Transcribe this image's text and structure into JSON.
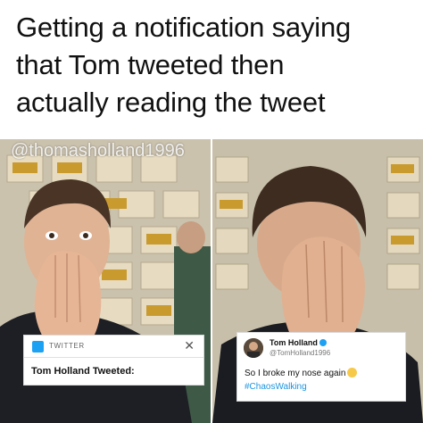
{
  "caption": {
    "line1": "Getting a notification saying",
    "line2": "that Tom tweeted then",
    "line3": "actually reading the tweet"
  },
  "watermark": "@thomasholland1996",
  "notification": {
    "app_label": "TWITTER",
    "close_symbol": "✕",
    "message": "Tom Holland Tweeted:"
  },
  "tweet": {
    "author_name": "Tom Holland",
    "author_handle": "@TomHolland1996",
    "text": "So I broke my nose again",
    "hashtag": "#ChaosWalking"
  },
  "colors": {
    "twitter_blue": "#1da1f2",
    "hashtag_blue": "#1b95e0"
  }
}
